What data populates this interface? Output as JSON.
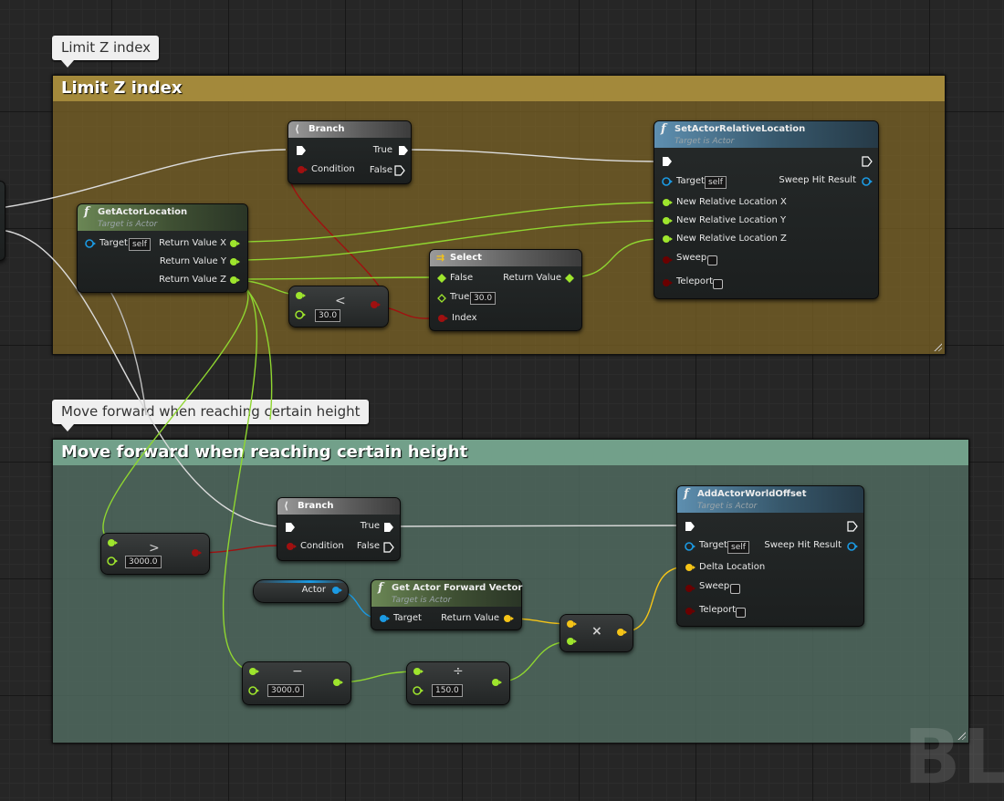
{
  "colors": {
    "exec": "#ffffff",
    "bool": "#8c0000",
    "float": "#9ee52d",
    "vector": "#f5c417",
    "object": "#1b9ae3",
    "comment_gold": "#a3893b",
    "comment_teal": "#72a08a"
  },
  "comments": [
    {
      "bubble": "Limit Z index",
      "title": "Limit Z index"
    },
    {
      "bubble": "Move forward when reaching certain height",
      "title": "Move forward when reaching certain height"
    }
  ],
  "nodes": {
    "branch1": {
      "title": "Branch",
      "condition": "Condition",
      "true": "True",
      "false": "False"
    },
    "get_actor_location": {
      "title": "GetActorLocation",
      "subtitle": "Target is Actor",
      "target": "Target",
      "target_value": "self",
      "return_x": "Return Value X",
      "return_y": "Return Value Y",
      "return_z": "Return Value Z"
    },
    "less1": {
      "value": "30.0",
      "op_icon": "less-than-icon"
    },
    "select": {
      "title": "Select",
      "false": "False",
      "true": "True",
      "true_value": "30.0",
      "index": "Index",
      "return": "Return Value"
    },
    "set_actor_relative_location": {
      "title": "SetActorRelativeLocation",
      "subtitle": "Target is Actor",
      "target": "Target",
      "target_value": "self",
      "x": "New Relative Location X",
      "y": "New Relative Location Y",
      "z": "New Relative Location Z",
      "sweep": "Sweep",
      "teleport": "Teleport",
      "sweep_hit": "Sweep Hit Result"
    },
    "greater1": {
      "value": "3000.0",
      "op_icon": "greater-than-icon"
    },
    "branch2": {
      "title": "Branch",
      "condition": "Condition",
      "true": "True",
      "false": "False"
    },
    "actor_var": {
      "label": "Actor"
    },
    "get_forward": {
      "title": "Get Actor Forward Vector",
      "subtitle": "Target is Actor",
      "target": "Target",
      "return": "Return Value"
    },
    "multiply": {
      "glyph": "×"
    },
    "subtract": {
      "value": "3000.0",
      "op_icon": "minus-icon"
    },
    "divide": {
      "value": "150.0",
      "op_icon": "divide-icon"
    },
    "add_world_offset": {
      "title": "AddActorWorldOffset",
      "subtitle": "Target is Actor",
      "target": "Target",
      "target_value": "self",
      "delta": "Delta Location",
      "sweep": "Sweep",
      "teleport": "Teleport",
      "sweep_hit": "Sweep Hit Result"
    }
  },
  "watermark": "BLU"
}
